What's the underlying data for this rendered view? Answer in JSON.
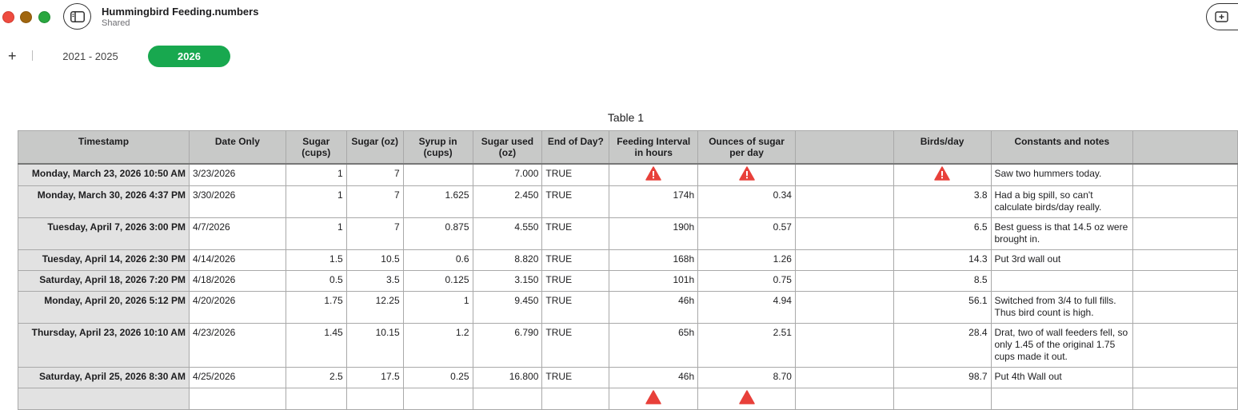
{
  "window": {
    "title": "Hummingbird Feeding.numbers",
    "subtitle": "Shared"
  },
  "icons": {
    "sidebar": "sidebar-toggle-icon",
    "add_sheet": "plus-icon",
    "add_view": "add-view-icon",
    "warning": "warning-triangle-icon"
  },
  "colors": {
    "active_tab": "#18a84f",
    "header_bg": "#c8c9c8",
    "row_header_bg": "#e2e2e2",
    "warning": "#e8403a"
  },
  "toolbar": {
    "add_sheet_label": "+"
  },
  "tabs": [
    {
      "label": "2021 - 2025",
      "active": false
    },
    {
      "label": "2026",
      "active": true
    }
  ],
  "table": {
    "title": "Table 1",
    "headers": [
      "Timestamp",
      "Date Only",
      "Sugar (cups)",
      "Sugar (oz)",
      "Syrup in (cups)",
      "Sugar used (oz)",
      "End of Day?",
      "Feeding Interval in hours",
      "Ounces of sugar per day",
      "",
      "Birds/day",
      "Constants and notes",
      ""
    ],
    "rows": [
      {
        "timestamp": "Monday, March 23, 2026 10:50 AM",
        "date": "3/23/2026",
        "sugar_cups": "1",
        "sugar_oz": "7",
        "syrup": "",
        "sugar_used": "7.000",
        "eod": "TRUE",
        "interval": "",
        "ounces": "",
        "blank": "",
        "birds": "",
        "notes": "Saw two hummers today."
      },
      {
        "timestamp": "Monday, March 30, 2026 4:37 PM",
        "date": "3/30/2026",
        "sugar_cups": "1",
        "sugar_oz": "7",
        "syrup": "1.625",
        "sugar_used": "2.450",
        "eod": "TRUE",
        "interval": "174h",
        "ounces": "0.34",
        "blank": "",
        "birds": "3.8",
        "notes": "Had a big spill, so can't calculate birds/day really."
      },
      {
        "timestamp": "Tuesday, April 7, 2026 3:00 PM",
        "date": "4/7/2026",
        "sugar_cups": "1",
        "sugar_oz": "7",
        "syrup": "0.875",
        "sugar_used": "4.550",
        "eod": "TRUE",
        "interval": "190h",
        "ounces": "0.57",
        "blank": "",
        "birds": "6.5",
        "notes": "Best guess is that 14.5 oz were brought in."
      },
      {
        "timestamp": "Tuesday, April 14, 2026 2:30 PM",
        "date": "4/14/2026",
        "sugar_cups": "1.5",
        "sugar_oz": "10.5",
        "syrup": "0.6",
        "sugar_used": "8.820",
        "eod": "TRUE",
        "interval": "168h",
        "ounces": "1.26",
        "blank": "",
        "birds": "14.3",
        "notes": "Put 3rd wall out"
      },
      {
        "timestamp": "Saturday, April 18, 2026 7:20 PM",
        "date": "4/18/2026",
        "sugar_cups": "0.5",
        "sugar_oz": "3.5",
        "syrup": "0.125",
        "sugar_used": "3.150",
        "eod": "TRUE",
        "interval": "101h",
        "ounces": "0.75",
        "blank": "",
        "birds": "8.5",
        "notes": ""
      },
      {
        "timestamp": "Monday, April 20, 2026 5:12 PM",
        "date": "4/20/2026",
        "sugar_cups": "1.75",
        "sugar_oz": "12.25",
        "syrup": "1",
        "sugar_used": "9.450",
        "eod": "TRUE",
        "interval": "46h",
        "ounces": "4.94",
        "blank": "",
        "birds": "56.1",
        "notes": "Switched from 3/4 to full fills. Thus bird count is high."
      },
      {
        "timestamp": "Thursday, April 23, 2026 10:10 AM",
        "date": "4/23/2026",
        "sugar_cups": "1.45",
        "sugar_oz": "10.15",
        "syrup": "1.2",
        "sugar_used": "6.790",
        "eod": "TRUE",
        "interval": "65h",
        "ounces": "2.51",
        "blank": "",
        "birds": "28.4",
        "notes": "Drat, two of wall feeders fell, so only 1.45 of the original 1.75 cups made it out."
      },
      {
        "timestamp": "Saturday, April 25, 2026 8:30 AM",
        "date": "4/25/2026",
        "sugar_cups": "2.5",
        "sugar_oz": "17.5",
        "syrup": "0.25",
        "sugar_used": "16.800",
        "eod": "TRUE",
        "interval": "46h",
        "ounces": "8.70",
        "blank": "",
        "birds": "98.7",
        "notes": "Put 4th Wall out"
      }
    ]
  }
}
